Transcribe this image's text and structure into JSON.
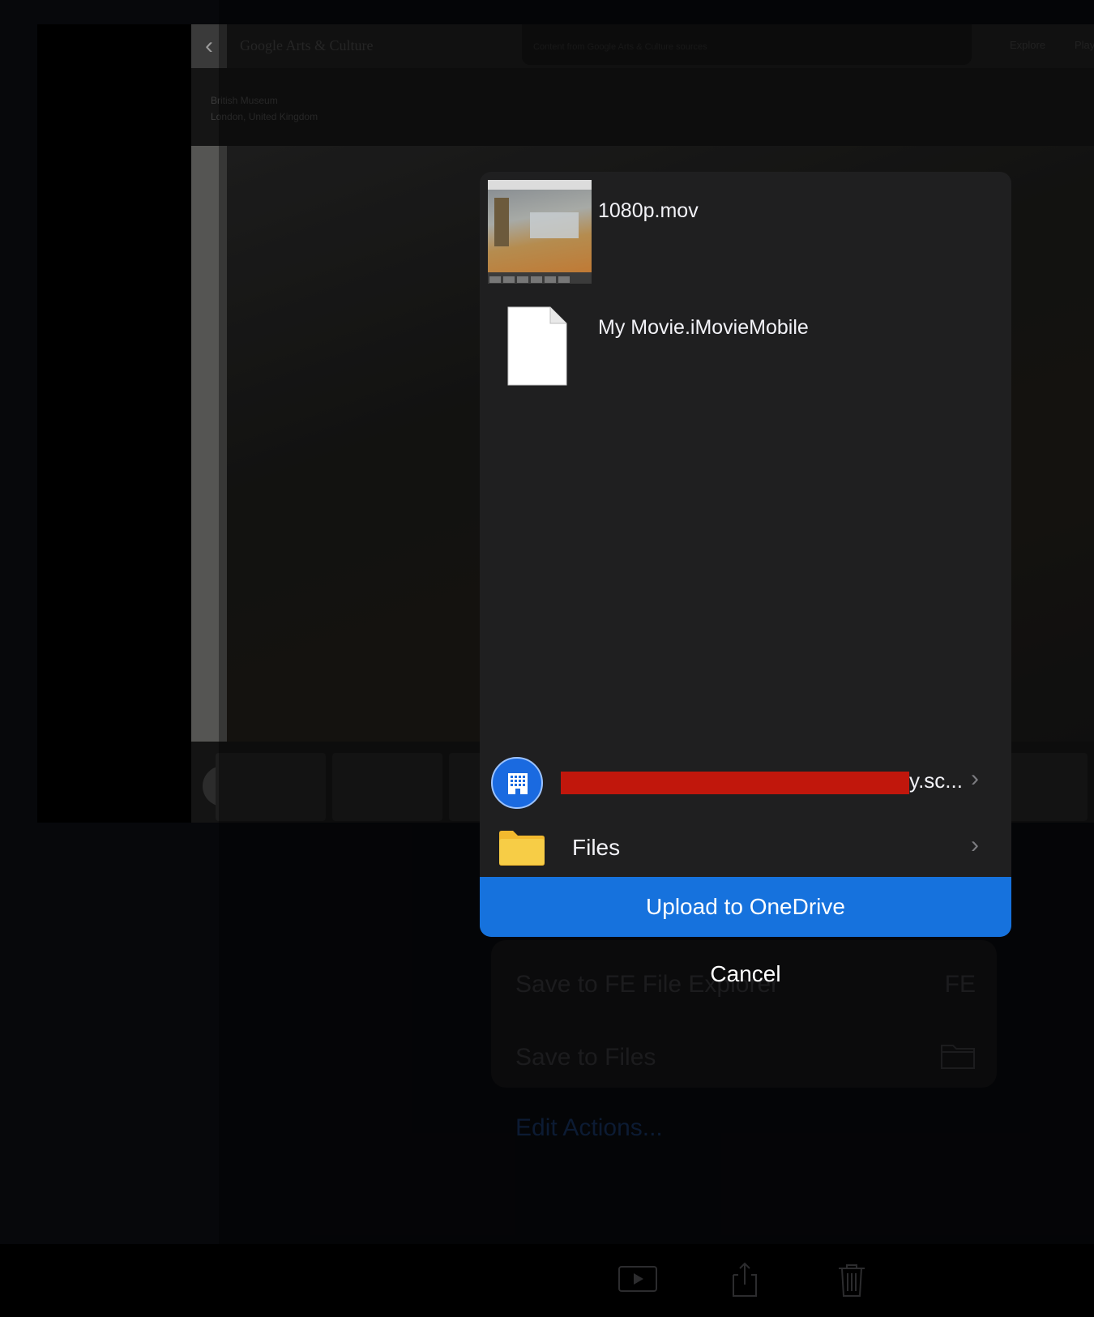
{
  "background_app": {
    "app_title": "Google Arts & Culture",
    "notice_text": "Content from Google Arts & Culture sources",
    "nav": [
      "Explore",
      "Play"
    ],
    "museum_name": "British Museum",
    "museum_location": "London, United Kingdom",
    "action_rows": [
      {
        "label": "Save to FE File Explorer",
        "icon": "fe-icon"
      },
      {
        "label": "Save to Files",
        "icon": "folder-outline-icon"
      }
    ],
    "edit_actions_label": "Edit Actions..."
  },
  "share_sheet": {
    "files": [
      {
        "name": "1080p.mov",
        "icon": "video-thumbnail"
      },
      {
        "name": "My Movie.iMovieMobile",
        "icon": "document-icon"
      }
    ],
    "locations": [
      {
        "label_suffix": "y.sc...",
        "icon": "onedrive-building-icon",
        "redacted": true
      },
      {
        "label": "Files",
        "icon": "folder-icon"
      }
    ],
    "upload_button": "Upload to OneDrive",
    "cancel_button": "Cancel"
  },
  "colors": {
    "sheet_background": "#1f1f20",
    "upload_button": "#1672dd",
    "redaction": "#c1170c",
    "folder": "#f7cd46"
  },
  "toolbar_icons": [
    "play-icon",
    "share-icon",
    "trash-icon"
  ]
}
